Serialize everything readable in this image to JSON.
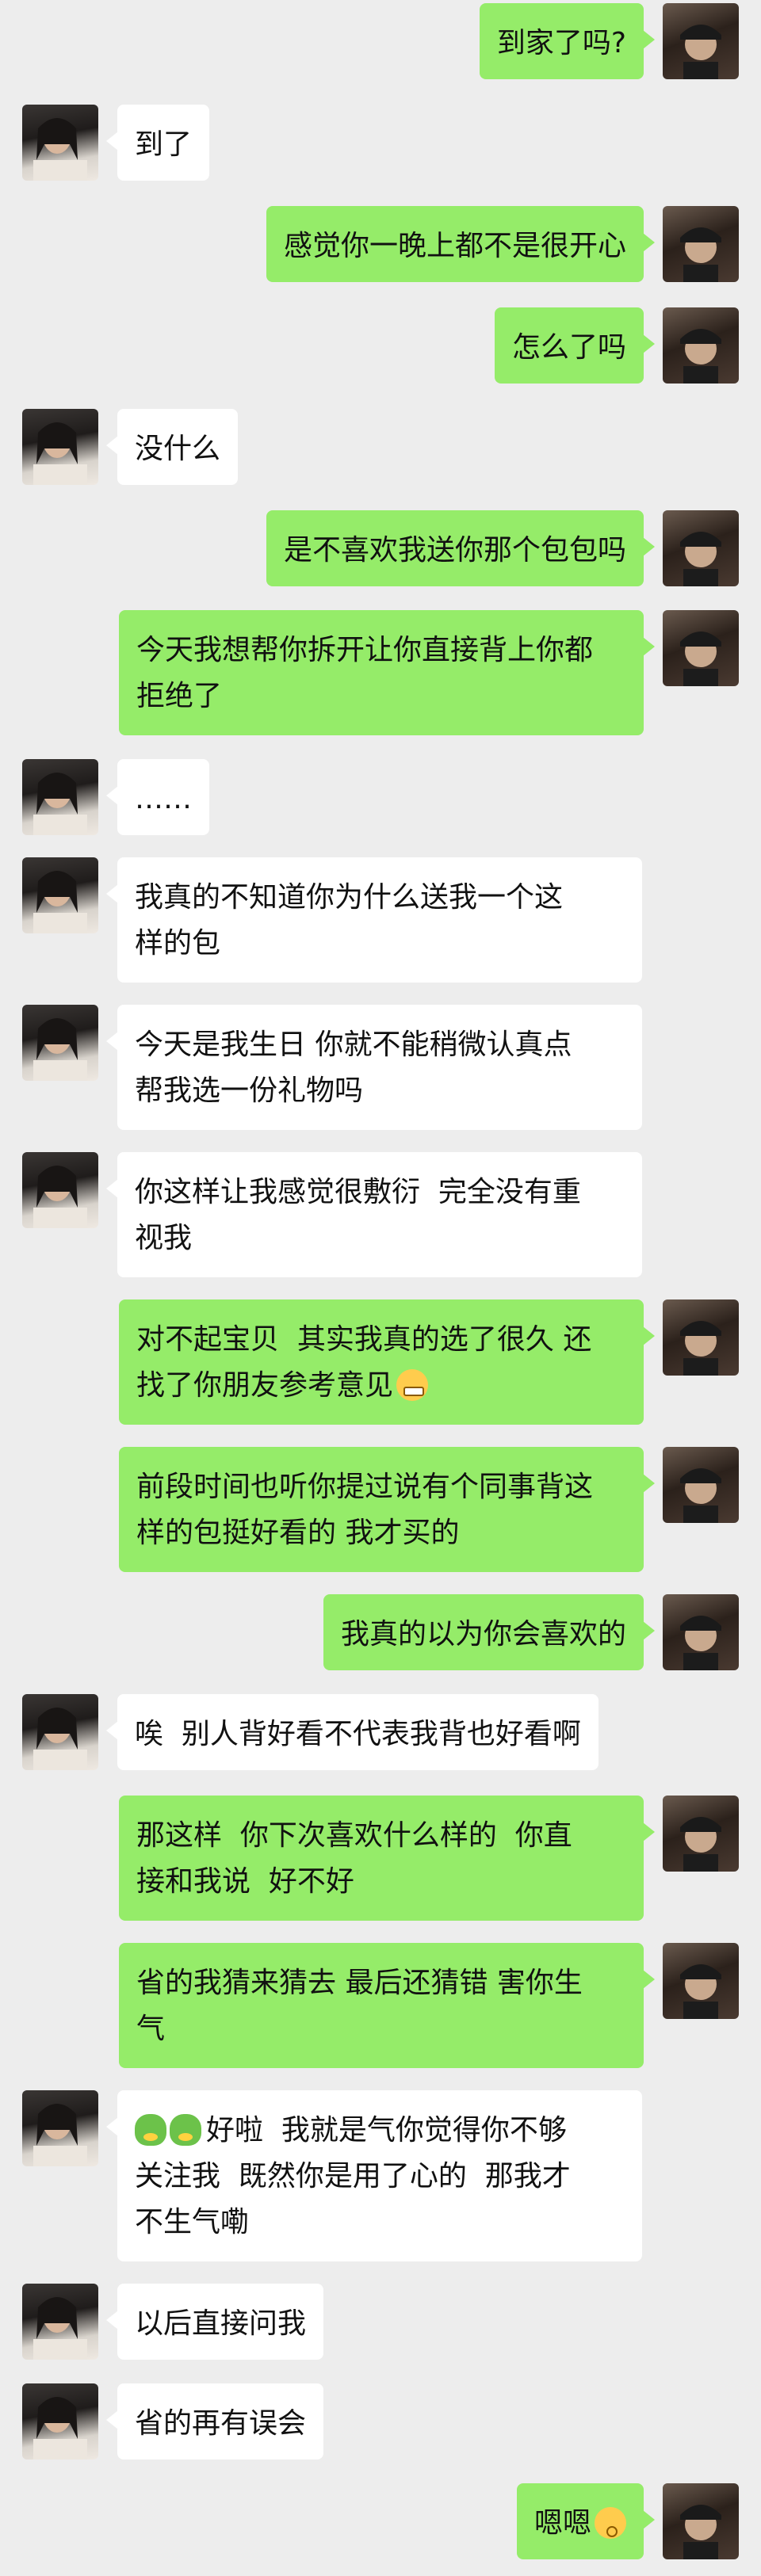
{
  "chat": {
    "messages": [
      {
        "side": "me",
        "text": "到家了吗?"
      },
      {
        "side": "her",
        "text": "到了"
      },
      {
        "side": "me",
        "text": "感觉你一晚上都不是很开心"
      },
      {
        "side": "me",
        "text": "怎么了吗"
      },
      {
        "side": "her",
        "text": "没什么"
      },
      {
        "side": "me",
        "text": "是不喜欢我送你那个包包吗"
      },
      {
        "side": "me",
        "text": "今天我想帮你拆开让你直接背上你都\n拒绝了"
      },
      {
        "side": "her",
        "text": "……"
      },
      {
        "side": "her",
        "text": "我真的不知道你为什么送我一个这\n样的包"
      },
      {
        "side": "her",
        "text": "今天是我生日 你就不能稍微认真点\n帮我选一份礼物吗"
      },
      {
        "side": "her",
        "text": "你这样让我感觉很敷衍  完全没有重\n视我"
      },
      {
        "side": "me",
        "text": "对不起宝贝  其实我真的选了很久 还\n找了你朋友参考意见",
        "emoji_after": "grimace-emoji"
      },
      {
        "side": "me",
        "text": "前段时间也听你提过说有个同事背这\n样的包挺好看的 我才买的"
      },
      {
        "side": "me",
        "text": "我真的以为你会喜欢的"
      },
      {
        "side": "her",
        "text": "唉  别人背好看不代表我背也好看啊"
      },
      {
        "side": "me",
        "text": "那这样  你下次喜欢什么样的  你直\n接和我说  好不好"
      },
      {
        "side": "me",
        "text": "省的我猜来猜去 最后还猜错 害你生\n气"
      },
      {
        "side": "her",
        "text": "好啦  我就是气你觉得你不够\n关注我  既然你是用了心的  那我才\n不生气嘞",
        "emoji_before": "green-creature-emoji"
      },
      {
        "side": "her",
        "text": "以后直接问我"
      },
      {
        "side": "her",
        "text": "省的再有误会"
      },
      {
        "side": "me",
        "text": "嗯嗯",
        "emoji_after": "shy-emoji"
      }
    ]
  },
  "colors": {
    "background": "#ededed",
    "outgoing_bubble": "#95ec69",
    "incoming_bubble": "#ffffff"
  },
  "avatars": {
    "me": "male-avatar-photo",
    "her": "female-avatar-photo"
  }
}
